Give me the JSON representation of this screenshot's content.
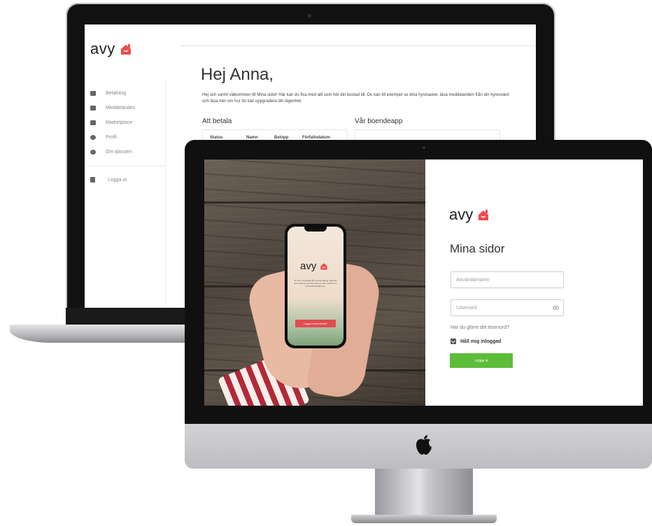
{
  "brand": {
    "name": "avy",
    "accent": "#ef4a4f"
  },
  "laptop": {
    "sidebar": {
      "items": [
        {
          "label": "Betalning",
          "icon": "credit-card-icon"
        },
        {
          "label": "Meddelanden",
          "icon": "chat-icon"
        },
        {
          "label": "Marketplace",
          "icon": "store-icon"
        },
        {
          "label": "Profil",
          "icon": "user-icon"
        },
        {
          "label": "Om tjänsten",
          "icon": "info-icon"
        }
      ],
      "logout": {
        "label": "Logga ut",
        "icon": "lock-icon"
      }
    },
    "main": {
      "greeting": "Hej Anna,",
      "intro": "Hej och varmt välkommen till Mina sidor! Här kan du fixa med allt som hör din bostad till. Du kan till exempel se dina hyresavier, läsa meddelanden från din hyresvärd och läsa mer om hur du kan uppgradera din lägenhet.",
      "payments": {
        "heading": "Att betala",
        "columns": [
          "Status",
          "Namn",
          "Belopp",
          "Förfallodatum"
        ]
      },
      "app": {
        "heading": "Vår boendeapp"
      }
    }
  },
  "imac": {
    "phone": {
      "text": "Du som hyresgäst får ett boendeapp! Här kan du se allt som du har nytta av, från nyheter om din bostad till tjänster.",
      "button": "Logga in med BankID"
    },
    "login": {
      "title": "Mina sidor",
      "username_placeholder": "Användarnamn",
      "password_placeholder": "Lösenord",
      "forgot": "Har du glömt ditt lösenord?",
      "remember": "Håll mig inloggad",
      "remember_checked": true,
      "submit": "Logga in",
      "submit_color": "#5cbd3a"
    }
  }
}
